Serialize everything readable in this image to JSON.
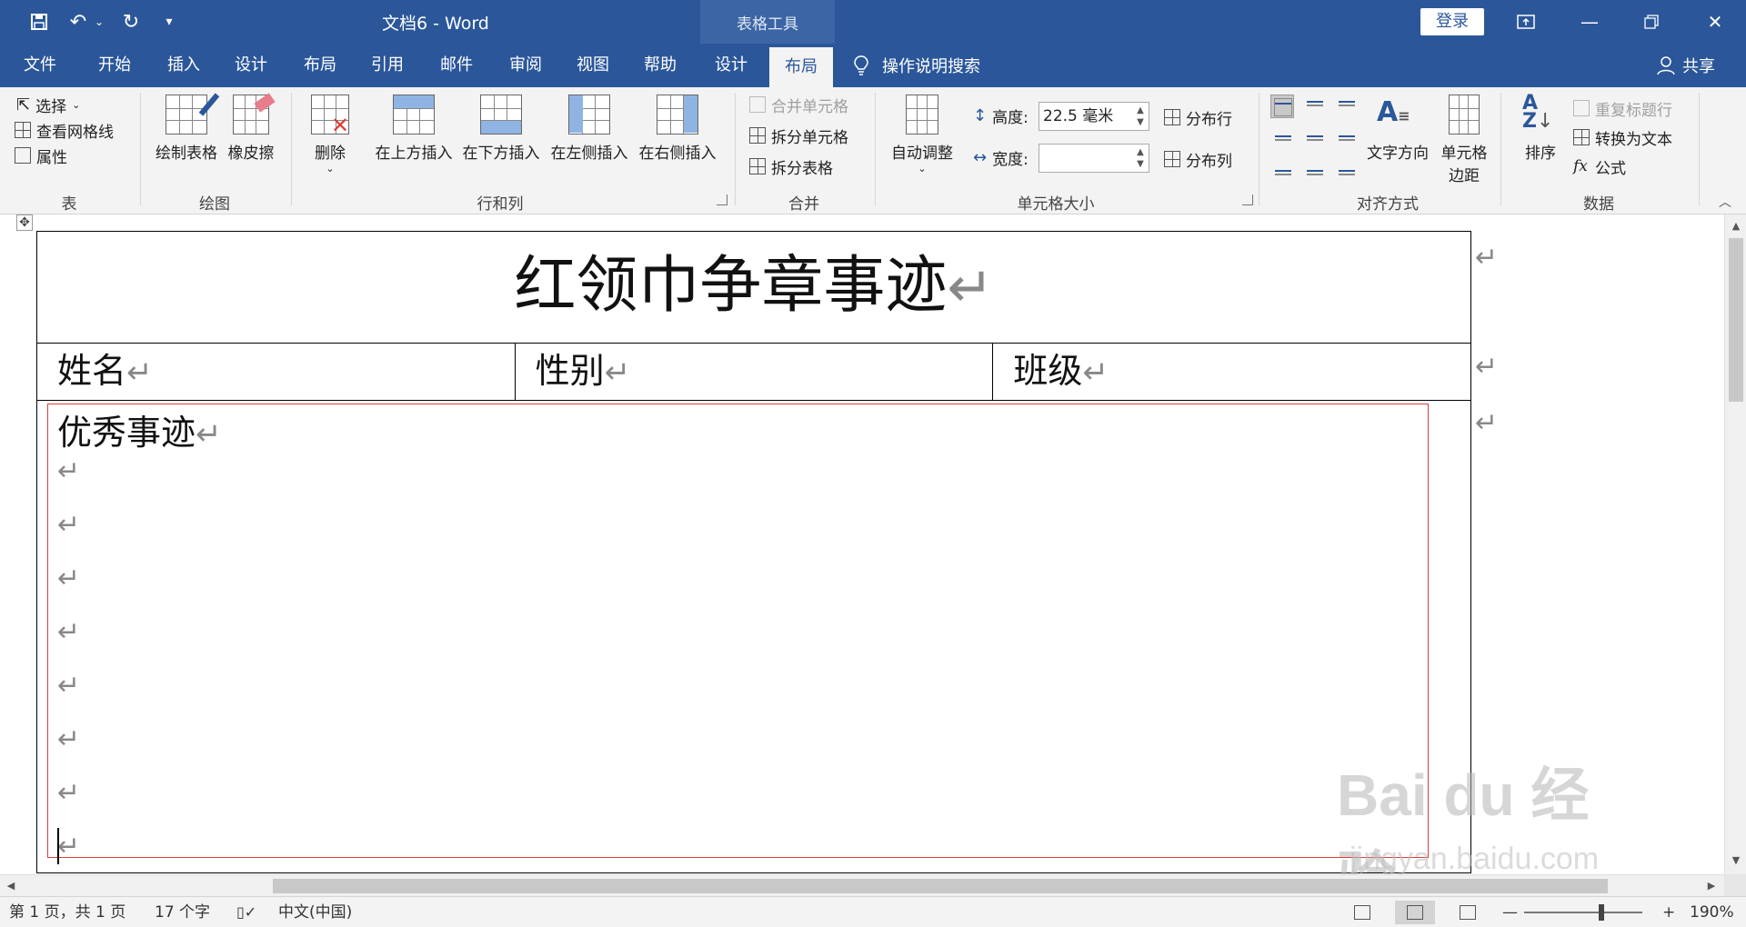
{
  "window": {
    "doc_title": "文档6  -  Word",
    "context_title": "表格工具",
    "login_label": "登录"
  },
  "tabs": [
    {
      "label": "文件"
    },
    {
      "label": "开始"
    },
    {
      "label": "插入"
    },
    {
      "label": "设计"
    },
    {
      "label": "布局"
    },
    {
      "label": "引用"
    },
    {
      "label": "邮件"
    },
    {
      "label": "审阅"
    },
    {
      "label": "视图"
    },
    {
      "label": "帮助"
    },
    {
      "label": "设计"
    },
    {
      "label": "布局"
    }
  ],
  "tellme": {
    "label": "操作说明搜索"
  },
  "share": {
    "label": "共享"
  },
  "ribbon": {
    "table": {
      "select": "选择",
      "gridlines": "查看网格线",
      "properties": "属性",
      "label": "表"
    },
    "draw": {
      "draw_table": "绘制表格",
      "eraser": "橡皮擦",
      "label": "绘图"
    },
    "rows_cols": {
      "delete": "删除",
      "insert_above": "在上方插入",
      "insert_below": "在下方插入",
      "insert_left": "在左侧插入",
      "insert_right": "在右侧插入",
      "label": "行和列"
    },
    "merge": {
      "merge_cells": "合并单元格",
      "split_cells": "拆分单元格",
      "split_table": "拆分表格",
      "label": "合并"
    },
    "cell_size": {
      "autofit": "自动调整",
      "height_label": "高度:",
      "height_value": "22.5 毫米",
      "width_label": "宽度:",
      "width_value": "",
      "distribute_rows": "分布行",
      "distribute_cols": "分布列",
      "label": "单元格大小"
    },
    "alignment": {
      "text_direction": "文字方向",
      "cell_margins_1": "单元格",
      "cell_margins_2": "边距",
      "label": "对齐方式"
    },
    "data": {
      "sort": "排序",
      "repeat_header": "重复标题行",
      "convert_text": "转换为文本",
      "formula": "公式",
      "label": "数据"
    }
  },
  "document": {
    "title": "红领巾争章事迹",
    "name_label": "姓名",
    "gender_label": "性别",
    "class_label": "班级",
    "deeds_label": "优秀事迹",
    "watermark": "Bai du 经验",
    "watermark_sub": "jingyan.baidu.com"
  },
  "status": {
    "page": "第 1 页，共 1 页",
    "words": "17 个字",
    "language": "中文(中国)",
    "zoom": "190%"
  }
}
